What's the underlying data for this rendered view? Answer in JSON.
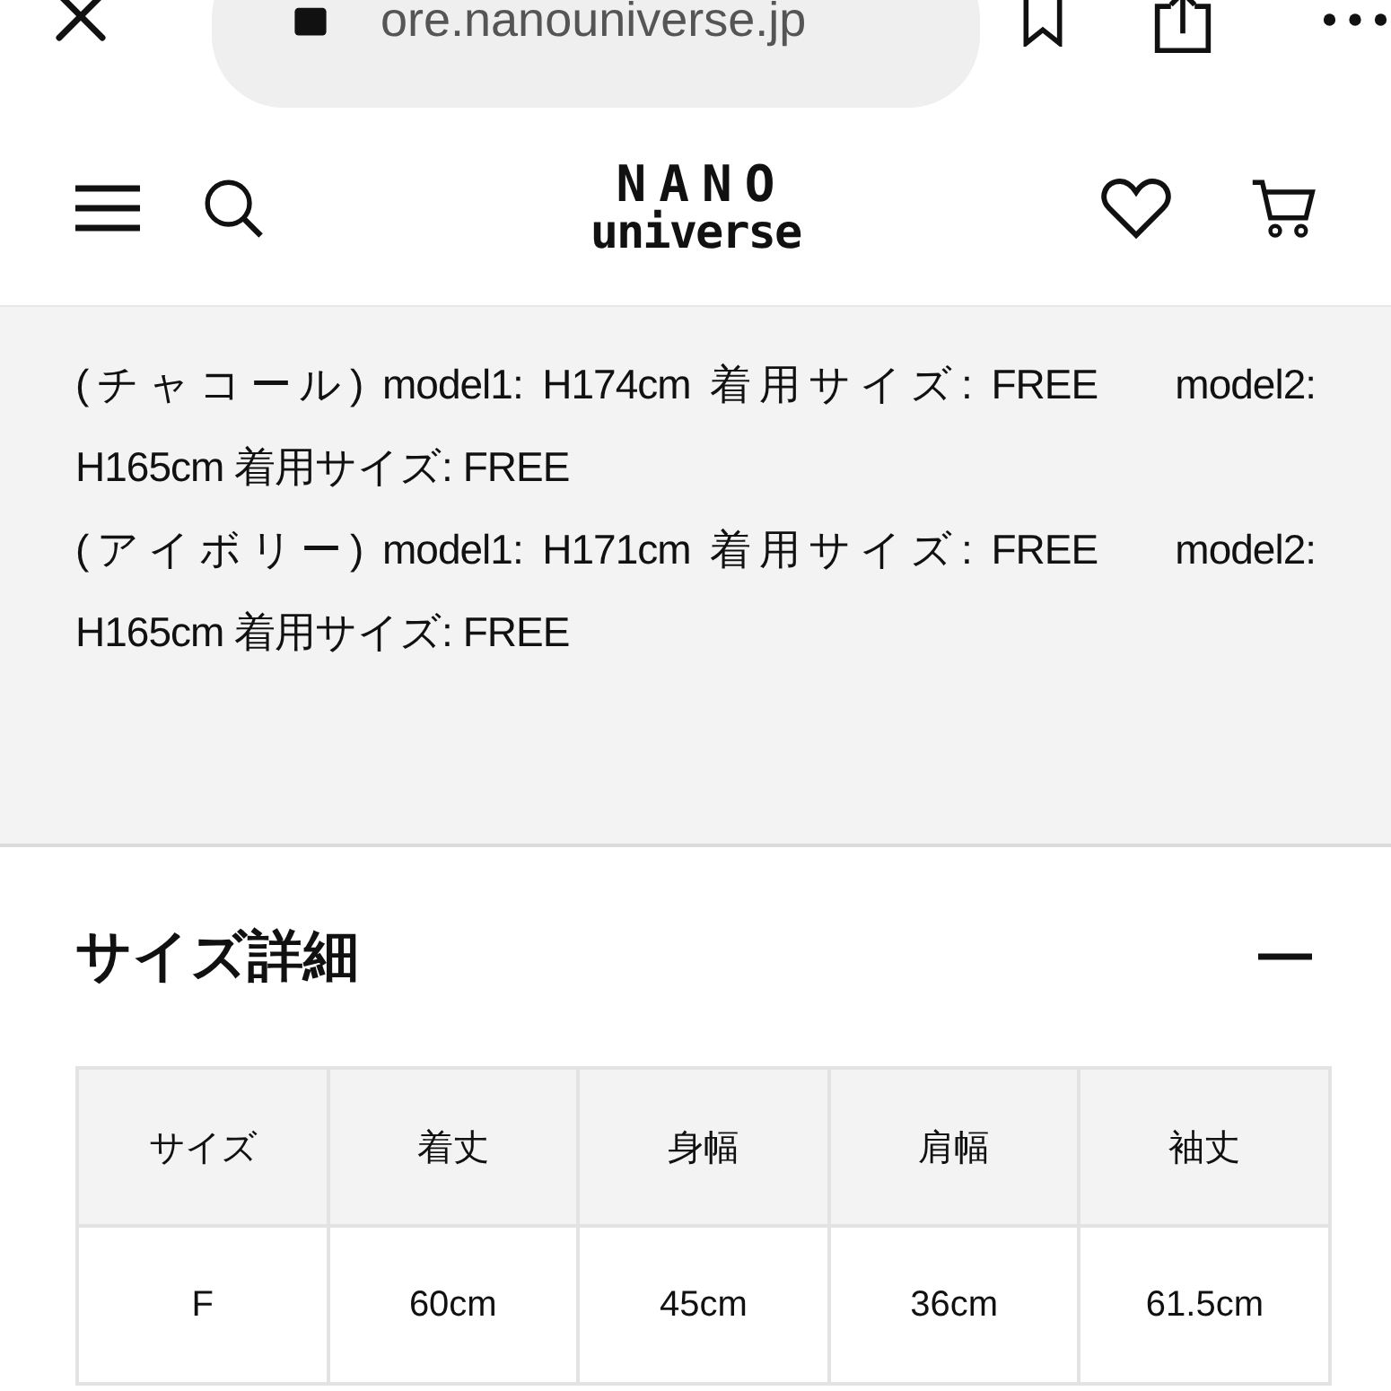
{
  "browser": {
    "url": "ore.nanouniverse.jp"
  },
  "header": {
    "logo_top": "NANO",
    "logo_bottom": "universe"
  },
  "notes": [
    "(チャコール) model1: H174cm 着用サイズ: FREE　 model2: H165cm 着用サイズ: FREE",
    "(アイボリー) model1: H171cm 着用サイズ: FREE　 model2: H165cm 着用サイズ: FREE"
  ],
  "size_section": {
    "title": "サイズ詳細",
    "expanded": true,
    "table": {
      "columns": [
        "サイズ",
        "着丈",
        "身幅",
        "肩幅",
        "袖丈"
      ],
      "rows": [
        [
          "F",
          "60cm",
          "45cm",
          "36cm",
          "61.5cm"
        ]
      ]
    }
  }
}
